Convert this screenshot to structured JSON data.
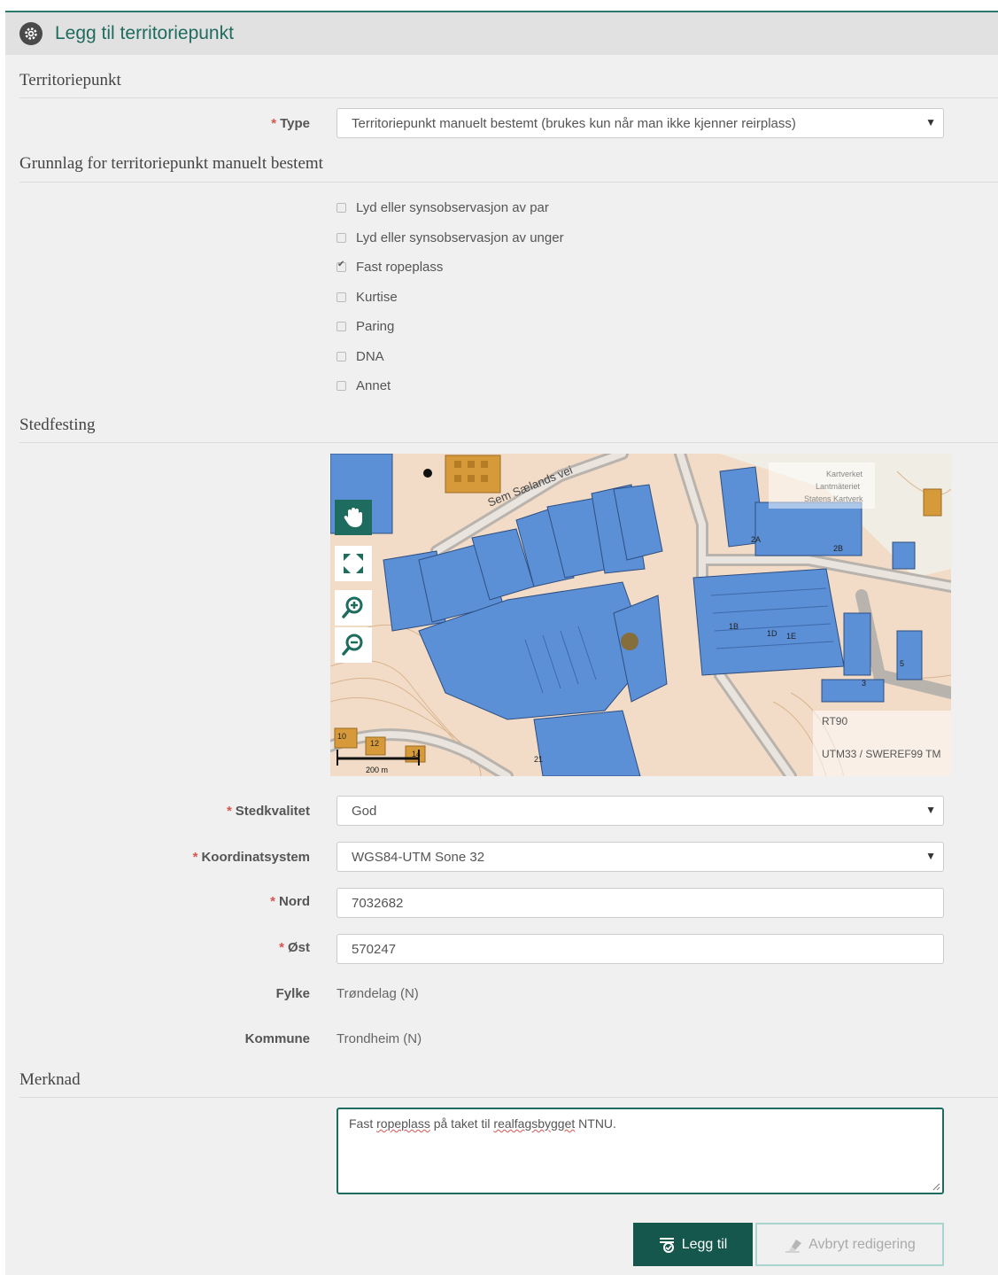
{
  "header": {
    "title": "Legg til territoriepunkt",
    "icon": "gear-icon"
  },
  "sections": {
    "territoriepunkt": "Territoriepunkt",
    "grunnlag": "Grunnlag for territoriepunkt manuelt bestemt",
    "stedfesting": "Stedfesting",
    "merknad": "Merknad"
  },
  "type": {
    "label": "Type",
    "value": "Territoriepunkt manuelt bestemt (brukes kun når man ikke kjenner reirplass)"
  },
  "checkboxes": [
    {
      "label": "Lyd eller synsobservasjon av par",
      "checked": false
    },
    {
      "label": "Lyd eller synsobservasjon av unger",
      "checked": false
    },
    {
      "label": "Fast ropeplass",
      "checked": true
    },
    {
      "label": "Kurtise",
      "checked": false
    },
    {
      "label": "Paring",
      "checked": false
    },
    {
      "label": "DNA",
      "checked": false
    },
    {
      "label": "Annet",
      "checked": false
    }
  ],
  "map": {
    "street_label": "Sem Sælands vei",
    "attribution": [
      "Kartverket",
      "Lantmäteriet",
      "Statens Kartverk"
    ],
    "projection_rt90": "RT90",
    "projection_utm": "UTM33 / SWEREF99 TM",
    "scale_label": "200 m",
    "building_labels": [
      "1B",
      "1D",
      "1E",
      "2A",
      "2B",
      "10",
      "12",
      "14",
      "21",
      "3",
      "5"
    ],
    "controls": [
      "hand-icon",
      "fullscreen-icon",
      "zoom-in-icon",
      "zoom-out-icon"
    ]
  },
  "stedkvalitet": {
    "label": "Stedkvalitet",
    "value": "God"
  },
  "koordinatsystem": {
    "label": "Koordinatsystem",
    "value": "WGS84-UTM Sone 32"
  },
  "nord": {
    "label": "Nord",
    "value": "7032682"
  },
  "ost": {
    "label": "Øst",
    "value": "570247"
  },
  "fylke": {
    "label": "Fylke",
    "value": "Trøndelag (N)"
  },
  "kommune": {
    "label": "Kommune",
    "value": "Trondheim (N)"
  },
  "merknad": {
    "part1": "Fast ",
    "word1": "ropeplass",
    "part2": " på taket til ",
    "word2": "realfagsbygget",
    "part3": " NTNU."
  },
  "buttons": {
    "add": "Legg til",
    "cancel": "Avbryt redigering"
  },
  "colors": {
    "accent": "#1e6b5f",
    "required": "#d9534f",
    "building": "#5b8fd6"
  }
}
